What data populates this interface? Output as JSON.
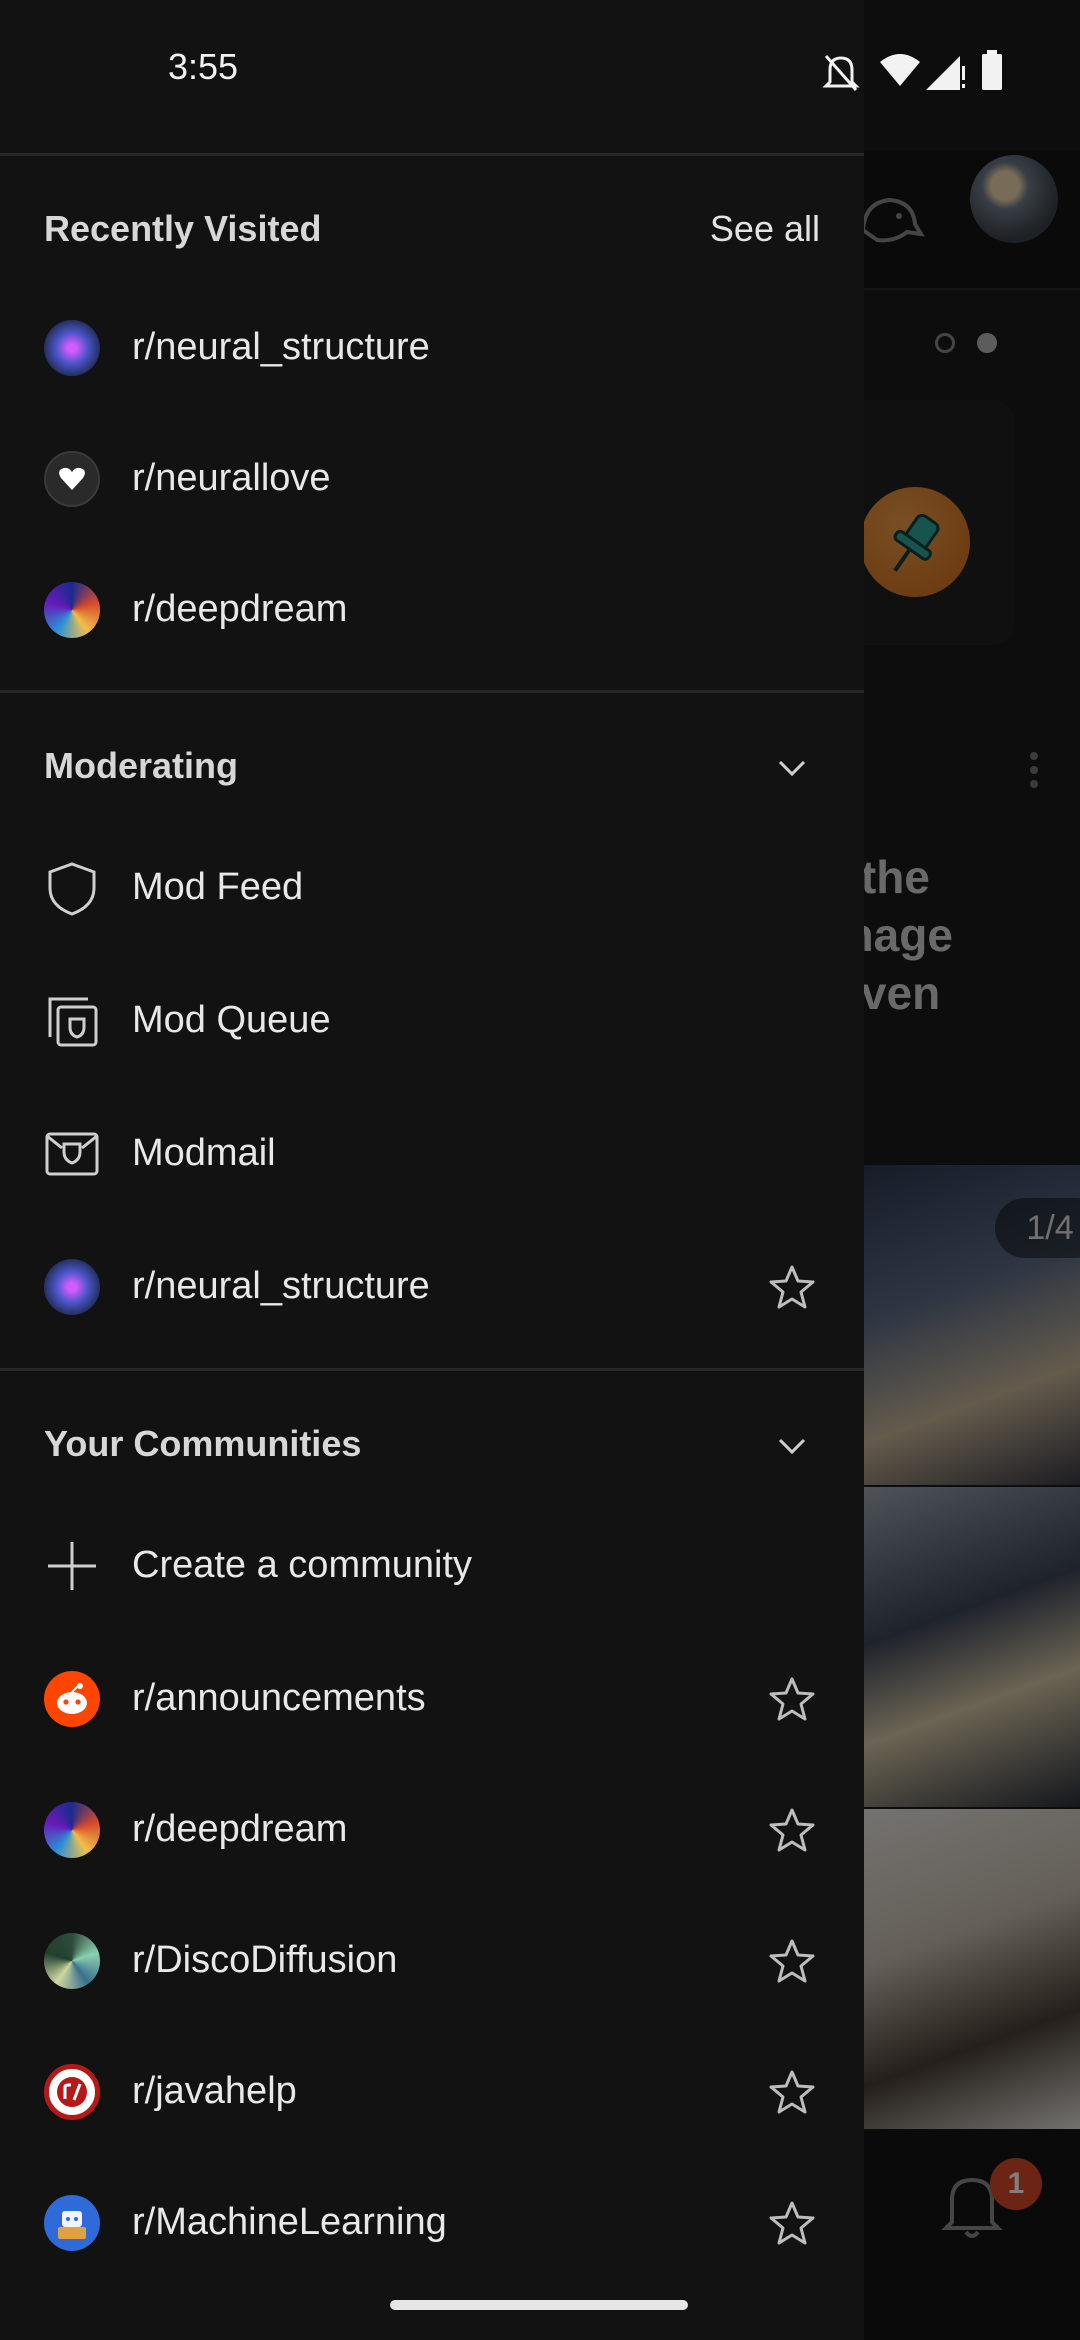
{
  "status_bar": {
    "time": "3:55"
  },
  "drawer": {
    "recently_visited": {
      "title": "Recently Visited",
      "see_all": "See all",
      "items": [
        {
          "label": "r/neural_structure",
          "icon": "neural-structure-avatar"
        },
        {
          "label": "r/neurallove",
          "icon": "neurallove-avatar"
        },
        {
          "label": "r/deepdream",
          "icon": "deepdream-avatar"
        }
      ]
    },
    "moderating": {
      "title": "Moderating",
      "items": [
        {
          "label": "Mod Feed",
          "icon": "shield-icon"
        },
        {
          "label": "Mod Queue",
          "icon": "mod-queue-icon"
        },
        {
          "label": "Modmail",
          "icon": "modmail-icon"
        },
        {
          "label": "r/neural_structure",
          "icon": "neural-structure-avatar"
        }
      ]
    },
    "communities": {
      "title": "Your Communities",
      "create_label": "Create a community",
      "items": [
        {
          "label": "r/announcements",
          "icon": "reddit-avatar"
        },
        {
          "label": "r/deepdream",
          "icon": "deepdream-avatar"
        },
        {
          "label": "r/DiscoDiffusion",
          "icon": "discodiffusion-avatar"
        },
        {
          "label": "r/javahelp",
          "icon": "javahelp-avatar"
        },
        {
          "label": "r/MachineLearning",
          "icon": "machinelearning-avatar"
        }
      ]
    }
  },
  "background": {
    "post_title_fragment": "g the\nimage\n (even",
    "gallery_counter": "1/4",
    "notification_count": "1"
  },
  "colors": {
    "drawer_bg": "#121212",
    "reddit_orange": "#ff4500",
    "badge": "#d84a2a",
    "separator": "#272727"
  }
}
